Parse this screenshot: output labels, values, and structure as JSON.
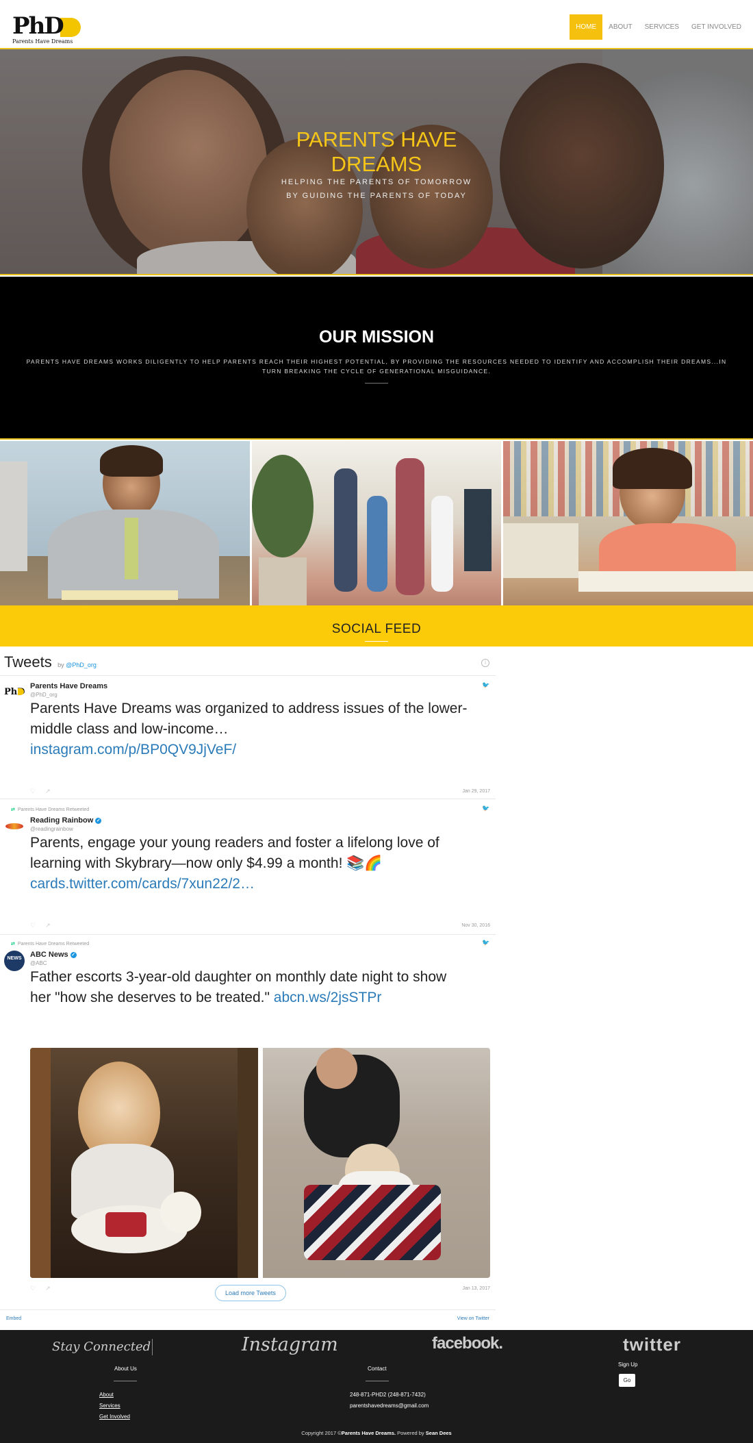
{
  "nav": {
    "logo_text": "PhD",
    "logo_sub": "Parents Have Dreams",
    "items": [
      {
        "label": "HOME",
        "active": true
      },
      {
        "label": "ABOUT"
      },
      {
        "label": "SERVICES"
      },
      {
        "label": "GET INVOLVED"
      }
    ]
  },
  "hero": {
    "title": "PARENTS HAVE DREAMS",
    "line1": "HELPING THE PARENTS OF TOMORROW",
    "line2": "BY GUIDING THE PARENTS OF TODAY"
  },
  "mission": {
    "title": "OUR MISSION",
    "text": "PARENTS HAVE DREAMS WORKS DILIGENTLY TO HELP PARENTS REACH THEIR HIGHEST POTENTIAL, BY PROVIDING THE RESOURCES NEEDED TO IDENTIFY AND ACCOMPLISH THEIR DREAMS...IN TURN BREAKING THE CYCLE OF GENERATIONAL MISGUIDANCE."
  },
  "social": {
    "title": "SOCIAL FEED"
  },
  "timeline": {
    "title": "Tweets",
    "by": "by",
    "handle": "@PhD_org",
    "tweets": [
      {
        "name": "Parents Have Dreams",
        "handle": "@PhD_org",
        "text": "Parents Have Dreams was organized to address issues of the lower-middle class and low-income…",
        "link": "instagram.com/p/BP0QV9JjVeF/",
        "date": "Jan 29, 2017"
      },
      {
        "retweet": "Parents Have Dreams Retweeted",
        "name": "Reading Rainbow",
        "handle": "@readingrainbow",
        "text": "Parents, engage your young readers and foster a lifelong love of learning with Skybrary—now only $4.99 a month! 📚🌈",
        "link": "cards.twitter.com/cards/7xun22/2…",
        "date": "Nov 30, 2016"
      },
      {
        "retweet": "Parents Have Dreams Retweeted",
        "name": "ABC News",
        "handle": "@ABC",
        "text": "Father escorts 3-year-old daughter on monthly date night to show her \"how she deserves to be treated.\"",
        "link": "abcn.ws/2jsSTPr",
        "date": "Jan 13, 2017"
      }
    ],
    "load_more": "Load more Tweets",
    "embed": "Embed",
    "view_on_twitter": "View on Twitter"
  },
  "footer": {
    "stay_connected": "Stay Connected",
    "instagram": "Instagram",
    "facebook": "facebook.",
    "twitter": "twitter",
    "about_title": "About Us",
    "about_links": [
      "About",
      "Services",
      "Get Involved"
    ],
    "contact_title": "Contact",
    "phone": "248-871-PHD2 (248-871-7432)",
    "email": "parentshavedreams@gmail.com",
    "signup_title": "Sign Up",
    "go": "Go",
    "copy_prefix": "Copyright 2017 ©",
    "copy_brand": "Parents Have Dreams.",
    "copy_powered": " Powered by ",
    "copy_author": "Sean Dees"
  },
  "colors": {
    "accent": "#f5c10e",
    "feed_bar": "#fbcb0a",
    "link": "#2b7bb9",
    "footer_bg": "#1b1b1b"
  }
}
